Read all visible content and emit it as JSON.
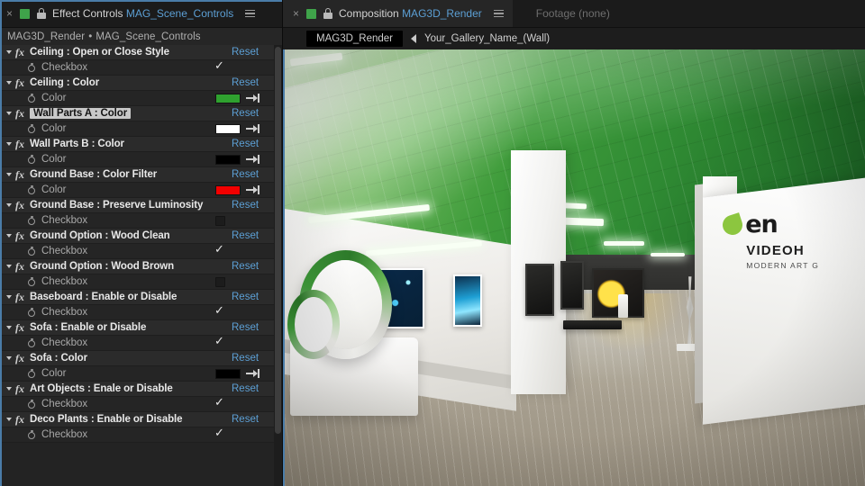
{
  "effect_controls": {
    "tab": {
      "close_label": "×",
      "title": "Effect Controls",
      "subject": "MAG_Scene_Controls",
      "menu_icon": "hamburger-menu-icon",
      "swatch_color": "#3fa34a",
      "lock_icon": "lock-icon"
    },
    "breadcrumb": {
      "comp": "MAG3D_Render",
      "separator": "•",
      "layer": "MAG_Scene_Controls"
    },
    "reset_label": "Reset",
    "property_label": "Checkbox",
    "color_label": "Color",
    "effects": [
      {
        "name": "Ceiling : Open or Close Style",
        "selected": false,
        "prop_type": "checkbox",
        "prop_label": "Checkbox",
        "checked": true
      },
      {
        "name": "Ceiling : Color",
        "selected": false,
        "prop_type": "color",
        "prop_label": "Color",
        "color": "#2fa12f"
      },
      {
        "name": "Wall Parts A : Color",
        "selected": true,
        "prop_type": "color",
        "prop_label": "Color",
        "color": "#ffffff"
      },
      {
        "name": "Wall Parts B : Color",
        "selected": false,
        "prop_type": "color",
        "prop_label": "Color",
        "color": "#000000"
      },
      {
        "name": "Ground Base : Color Filter",
        "selected": false,
        "prop_type": "color",
        "prop_label": "Color",
        "color": "#f30000"
      },
      {
        "name": "Ground Base : Preserve Luminosity",
        "selected": false,
        "prop_type": "checkbox",
        "prop_label": "Checkbox",
        "checked": false
      },
      {
        "name": "Ground Option : Wood Clean",
        "selected": false,
        "prop_type": "checkbox",
        "prop_label": "Checkbox",
        "checked": true
      },
      {
        "name": "Ground Option : Wood Brown",
        "selected": false,
        "prop_type": "checkbox",
        "prop_label": "Checkbox",
        "checked": false
      },
      {
        "name": "Baseboard : Enable or Disable",
        "selected": false,
        "prop_type": "checkbox",
        "prop_label": "Checkbox",
        "checked": true
      },
      {
        "name": "Sofa : Enable or Disable",
        "selected": false,
        "prop_type": "checkbox",
        "prop_label": "Checkbox",
        "checked": true
      },
      {
        "name": "Sofa : Color",
        "selected": false,
        "prop_type": "color",
        "prop_label": "Color",
        "color": "#000000"
      },
      {
        "name": "Art Objects : Enale or Disable",
        "selected": false,
        "prop_type": "checkbox",
        "prop_label": "Checkbox",
        "checked": true
      },
      {
        "name": "Deco Plants : Enable or Disable",
        "selected": false,
        "prop_type": "checkbox",
        "prop_label": "Checkbox",
        "checked": true
      }
    ]
  },
  "composition": {
    "tab": {
      "close_label": "×",
      "title": "Composition",
      "subject": "MAG3D_Render",
      "menu_icon": "hamburger-menu-icon",
      "swatch_color": "#3fa34a",
      "lock_icon": "lock-icon"
    },
    "footage_tab_label": "Footage (none)",
    "breadcrumb_chip": "MAG3D_Render",
    "breadcrumb_name": "Your_Gallery_Name_(Wall)"
  },
  "viewer": {
    "logo": {
      "wordmark": "en",
      "line2": "VIDEOH",
      "line3": "MODERN ART G",
      "leaf_color": "#8cc63f"
    }
  }
}
